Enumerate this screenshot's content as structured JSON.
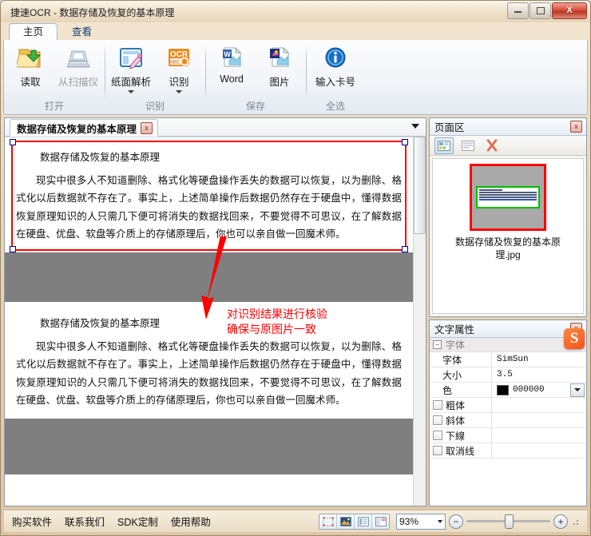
{
  "window": {
    "title": "捷速OCR - 数据存储及恢复的基本原理",
    "minimize_label": "最小化",
    "maximize_label": "最大化",
    "close_label": "X"
  },
  "ribbon": {
    "tabs": [
      {
        "label": "主页",
        "active": true
      },
      {
        "label": "查看",
        "active": false
      }
    ],
    "groups": [
      {
        "name": "打开",
        "items": [
          {
            "label": "读取",
            "icon": "open-folder-icon",
            "enabled": true,
            "caret": false
          },
          {
            "label": "从扫描仪",
            "icon": "scanner-icon",
            "enabled": false,
            "caret": false
          }
        ]
      },
      {
        "name": "识别",
        "items": [
          {
            "label": "纸面解析",
            "icon": "page-analysis-icon",
            "enabled": true,
            "caret": true
          },
          {
            "label": "识别",
            "icon": "ocr-icon",
            "enabled": true,
            "caret": true
          }
        ]
      },
      {
        "name": "保存",
        "items": [
          {
            "label": "Word",
            "icon": "word-doc-icon",
            "enabled": true,
            "caret": false
          },
          {
            "label": "图片",
            "icon": "image-doc-icon",
            "enabled": true,
            "caret": false
          }
        ]
      },
      {
        "name": "全选",
        "items": [
          {
            "label": "输入卡号",
            "icon": "info-icon",
            "enabled": true,
            "caret": false
          }
        ]
      }
    ]
  },
  "document": {
    "tab_label": "数据存储及恢复的基本原理",
    "tab_close_label": "x",
    "heading": "数据存储及恢复的基本原理",
    "paragraph_top": "现实中很多人不知道删除、格式化等硬盘操作丢失的数据可以恢复，以为删除、格式化以后数据就不存在了。事实上，上述简单操作后数据仍然存在于硬盘中，懂得数据恢复原理知识的人只需几下便可将消失的数据找回来，不要觉得不可思议，在了解数据在硬盘、优盘、软盘等介质上的存储原理后，你也可以亲自做一回魔术师。",
    "paragraph_bottom": "现实中很多人不知道删除、格式化等硬盘操作丢失的数据可以恢复，以为删除、格式化以后数据就不存在了。事实上，上述简单操作后数据仍然存在于硬盘中，懂得数据恢复原理知识的人只需几下便可将消失的数据找回来，不要觉得不可思议，在了解数据在硬盘、优盘、软盘等介质上的存储原理后，你也可以亲自做一回魔术师。",
    "link_words": [
      "软盘",
      "魔术师"
    ],
    "annotation_line1": "对识别结果进行核验",
    "annotation_line2": "确保与原图片一致",
    "annotation_color": "#ff0000",
    "selection_color": "#ff0000"
  },
  "page_panel": {
    "title": "页面区",
    "close_label": "x",
    "toolbar": [
      {
        "name": "thumbnail-view-button",
        "icon": "thumbnail-grid-icon",
        "active": true
      },
      {
        "name": "list-view-button",
        "icon": "list-view-icon",
        "active": false
      },
      {
        "name": "delete-page-button",
        "icon": "red-x-icon",
        "active": false
      }
    ],
    "thumbnail_caption": "数据存储及恢复的基本原理.jpg",
    "thumbnail_frame_color": "#ff0000",
    "thumbnail_region_color": "#00c000"
  },
  "text_properties": {
    "title": "文字属性",
    "close_label": "x",
    "group_label": "字体",
    "rows": [
      {
        "key": "字体",
        "value": "SimSun",
        "type": "text"
      },
      {
        "key": "大小",
        "value": "3.5",
        "type": "text"
      },
      {
        "key": "色",
        "value": "000000",
        "type": "color",
        "swatch": "#000000"
      },
      {
        "key": "粗体",
        "value": "",
        "type": "checkbox",
        "checked": false
      },
      {
        "key": "斜体",
        "value": "",
        "type": "checkbox",
        "checked": false
      },
      {
        "key": "下線",
        "value": "",
        "type": "checkbox",
        "checked": false
      },
      {
        "key": "取消线",
        "value": "",
        "type": "checkbox",
        "checked": false
      }
    ],
    "watermark": "S"
  },
  "status_bar": {
    "links": [
      {
        "label": "购买软件"
      },
      {
        "label": "联系我们"
      },
      {
        "label": "SDK定制"
      },
      {
        "label": "使用帮助"
      }
    ],
    "view_buttons": [
      {
        "name": "fit-selection-button",
        "icon": "crop-marks-icon"
      },
      {
        "name": "image-view-button",
        "icon": "picture-icon"
      },
      {
        "name": "text-view-button",
        "icon": "text-lines-icon"
      },
      {
        "name": "split-view-button",
        "icon": "split-panes-icon"
      }
    ],
    "zoom_value": "93%",
    "zoom_out_label": "−",
    "zoom_in_label": "+"
  }
}
